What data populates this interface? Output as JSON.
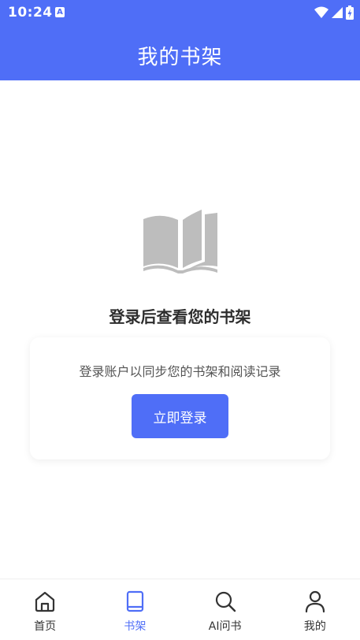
{
  "status_bar": {
    "time": "10:24",
    "notification_icon": "A"
  },
  "app_bar": {
    "title": "我的书架"
  },
  "empty_state": {
    "icon": "open-book-icon",
    "title": "登录后查看您的书架",
    "description": "登录账户以同步您的书架和阅读记录",
    "login_button_label": "立即登录"
  },
  "bottom_nav": {
    "items": [
      {
        "label": "首页",
        "icon": "home-icon",
        "active": false
      },
      {
        "label": "书架",
        "icon": "book-icon",
        "active": true
      },
      {
        "label": "AI问书",
        "icon": "search-icon",
        "active": false
      },
      {
        "label": "我的",
        "icon": "person-icon",
        "active": false
      }
    ]
  },
  "colors": {
    "primary": "#4f6ef7",
    "icon_gray": "#bdbdbd",
    "text_dark": "#2d2d2d"
  }
}
